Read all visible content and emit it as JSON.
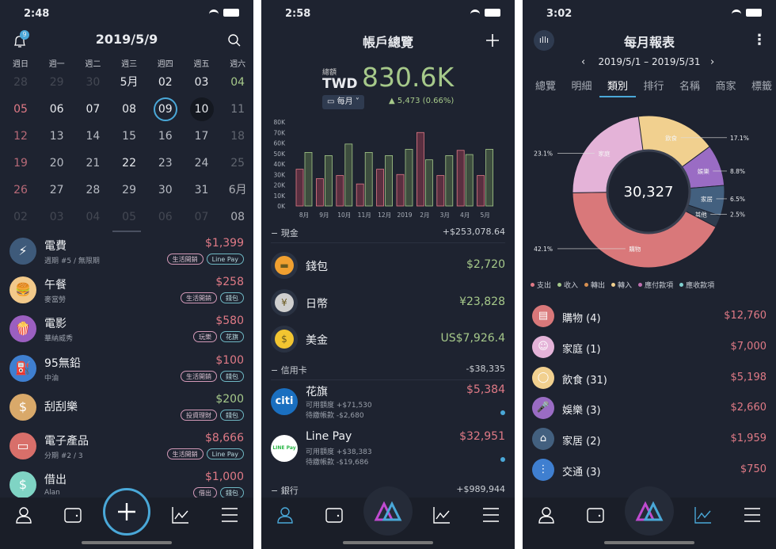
{
  "colors": {
    "bg": "#1e2330",
    "accent": "#4aa8d8",
    "expense": "#e07a86",
    "income": "#a6c98a"
  },
  "screen1": {
    "time": "2:48",
    "title": "2019/5/9",
    "notification_count": "9",
    "weekdays": [
      "週日",
      "週一",
      "週二",
      "週三",
      "週四",
      "週五",
      "週六"
    ],
    "weeks": [
      [
        "28",
        "29",
        "30",
        "5月",
        "02",
        "03",
        "04"
      ],
      [
        "05",
        "06",
        "07",
        "08",
        "09",
        "10",
        "11"
      ],
      [
        "12",
        "13",
        "14",
        "15",
        "16",
        "17",
        "18"
      ],
      [
        "19",
        "20",
        "21",
        "22",
        "23",
        "24",
        "25"
      ],
      [
        "26",
        "27",
        "28",
        "29",
        "30",
        "31",
        "6月"
      ],
      [
        "02",
        "03",
        "04",
        "05",
        "06",
        "07",
        "08"
      ]
    ],
    "selected_day": "09",
    "today_day": "10",
    "transactions": [
      {
        "title": "電費",
        "sub": "週期 #5 / 無限期",
        "amount": "$1,399",
        "type": "expense",
        "tags": [
          "生活開銷",
          "Line Pay"
        ],
        "icon": "plug-icon",
        "color": "#3e5a7a",
        "glyph": "⚡"
      },
      {
        "title": "午餐",
        "sub": "麥當勞",
        "amount": "$258",
        "type": "expense",
        "tags": [
          "生活開銷",
          "錢包"
        ],
        "icon": "burger-icon",
        "color": "#f2c98a",
        "glyph": "🍔"
      },
      {
        "title": "電影",
        "sub": "華納威秀",
        "amount": "$580",
        "type": "expense",
        "tags": [
          "玩樂",
          "花旗"
        ],
        "icon": "popcorn-icon",
        "color": "#9b5fc0",
        "glyph": "🍿"
      },
      {
        "title": "95無鉛",
        "sub": "中油",
        "amount": "$100",
        "type": "expense",
        "tags": [
          "生活開銷",
          "錢包"
        ],
        "icon": "gas-pump-icon",
        "color": "#3f7fd0",
        "glyph": "⛽"
      },
      {
        "title": "刮刮樂",
        "sub": "",
        "amount": "$200",
        "type": "income",
        "tags": [
          "投資理財",
          "錢包"
        ],
        "icon": "lottery-icon",
        "color": "#d9a96a",
        "glyph": "$"
      },
      {
        "title": "電子產品",
        "sub": "分期 #2 / 3",
        "amount": "$8,666",
        "type": "expense",
        "tags": [
          "生活開銷",
          "Line Pay"
        ],
        "icon": "laptop-icon",
        "color": "#d86f6a",
        "glyph": "▭"
      },
      {
        "title": "借出",
        "sub": "Alan",
        "amount": "$1,000",
        "type": "expense",
        "tags": [
          "借出",
          "錢包"
        ],
        "icon": "lend-icon",
        "color": "#7fd4c4",
        "glyph": "$"
      }
    ]
  },
  "screen2": {
    "time": "2:58",
    "title": "帳戶總覽",
    "total_label": "總額",
    "currency": "TWD",
    "total": "830.6K",
    "period": "每月",
    "change": "▲ 5,473 (0.66%)",
    "sections": [
      {
        "name": "現金",
        "total": "+$253,078.64",
        "items": [
          {
            "name": "錢包",
            "amount": "$2,720",
            "icon": "wallet-icon",
            "color": "#f0a030",
            "glyph": "▬"
          },
          {
            "name": "日幣",
            "amount": "¥23,828",
            "icon": "yen-coin-icon",
            "color": "#cfcfcf",
            "glyph": "¥"
          },
          {
            "name": "美金",
            "amount": "US$7,926.4",
            "icon": "dollar-coin-icon",
            "color": "#f2c531",
            "glyph": "$"
          }
        ]
      },
      {
        "name": "信用卡",
        "total": "-$38,335",
        "items": [
          {
            "name": "花旗",
            "amount": "$5,384",
            "limit": "可用額度 +$71,530",
            "due": "待繳帳款 -$2,680",
            "icon": "citi-logo-icon",
            "logo": "citi"
          },
          {
            "name": "Line Pay",
            "amount": "$32,951",
            "limit": "可用額度 +$38,383",
            "due": "待繳帳款 -$19,686",
            "icon": "linepay-logo-icon",
            "logo": "LINE Pay"
          }
        ]
      },
      {
        "name": "銀行",
        "total": "+$989,944"
      }
    ]
  },
  "chart_data": {
    "type": "bar",
    "categories": [
      "8月",
      "9月",
      "10月",
      "11月",
      "12月",
      "2019",
      "2月",
      "3月",
      "4月",
      "5月"
    ],
    "series": [
      {
        "values": [
          35,
          26,
          29,
          21,
          35,
          30,
          70,
          29,
          53,
          29
        ],
        "color": "#e07a86"
      },
      {
        "values": [
          51,
          48,
          59,
          51,
          48,
          54,
          44,
          48,
          49,
          54
        ],
        "color": "#a6c98a"
      }
    ],
    "yticks": [
      "0K",
      "10K",
      "20K",
      "30K",
      "40K",
      "50K",
      "60K",
      "70K",
      "80K"
    ],
    "ylim": [
      0,
      80
    ],
    "unit": "K"
  },
  "screen3": {
    "time": "3:02",
    "title": "每月報表",
    "range": "2019/5/1 – 2019/5/31",
    "tabs": [
      "總覽",
      "明細",
      "類別",
      "排行",
      "名稱",
      "商家",
      "標籤"
    ],
    "active_tab": 2,
    "donut_total": "30,327",
    "slices": [
      {
        "label": "飲食",
        "pct": 17.1,
        "pct_label": "17.1%",
        "color": "#f1d08f"
      },
      {
        "label": "娛樂",
        "pct": 8.8,
        "pct_label": "8.8%",
        "color": "#9a6cc4"
      },
      {
        "label": "家居",
        "pct": 6.5,
        "pct_label": "6.5%",
        "color": "#43607f"
      },
      {
        "label": "其他",
        "pct": 2.5,
        "pct_label": "2.5%",
        "color": "#2f3d4f"
      },
      {
        "label": "購物",
        "pct": 42.1,
        "pct_label": "42.1%",
        "color": "#d9787a"
      },
      {
        "label": "家庭",
        "pct": 23.1,
        "pct_label": "23.1%",
        "color": "#e4b3d8"
      }
    ],
    "legend": [
      {
        "label": "支出",
        "color": "#e07a86"
      },
      {
        "label": "收入",
        "color": "#a6c98a"
      },
      {
        "label": "轉出",
        "color": "#d89050"
      },
      {
        "label": "轉入",
        "color": "#f1d08f"
      },
      {
        "label": "應付款項",
        "color": "#c070b0"
      },
      {
        "label": "應收款項",
        "color": "#80d0d0"
      }
    ],
    "categories": [
      {
        "name": "購物 (4)",
        "amount": "$12,760",
        "icon": "shop-icon",
        "color": "#d9787a",
        "glyph": "▤"
      },
      {
        "name": "家庭 (1)",
        "amount": "$7,000",
        "icon": "baby-icon",
        "color": "#e4b3d8",
        "glyph": "☺"
      },
      {
        "name": "飲食 (31)",
        "amount": "$5,198",
        "icon": "plate-icon",
        "color": "#f1d08f",
        "glyph": "◯"
      },
      {
        "name": "娛樂 (3)",
        "amount": "$2,660",
        "icon": "microphone-icon",
        "color": "#9a6cc4",
        "glyph": "🎤"
      },
      {
        "name": "家居 (2)",
        "amount": "$1,959",
        "icon": "house-icon",
        "color": "#43607f",
        "glyph": "⌂"
      },
      {
        "name": "交通 (3)",
        "amount": "$750",
        "icon": "traffic-light-icon",
        "color": "#3f7fd0",
        "glyph": "⋮"
      }
    ]
  }
}
